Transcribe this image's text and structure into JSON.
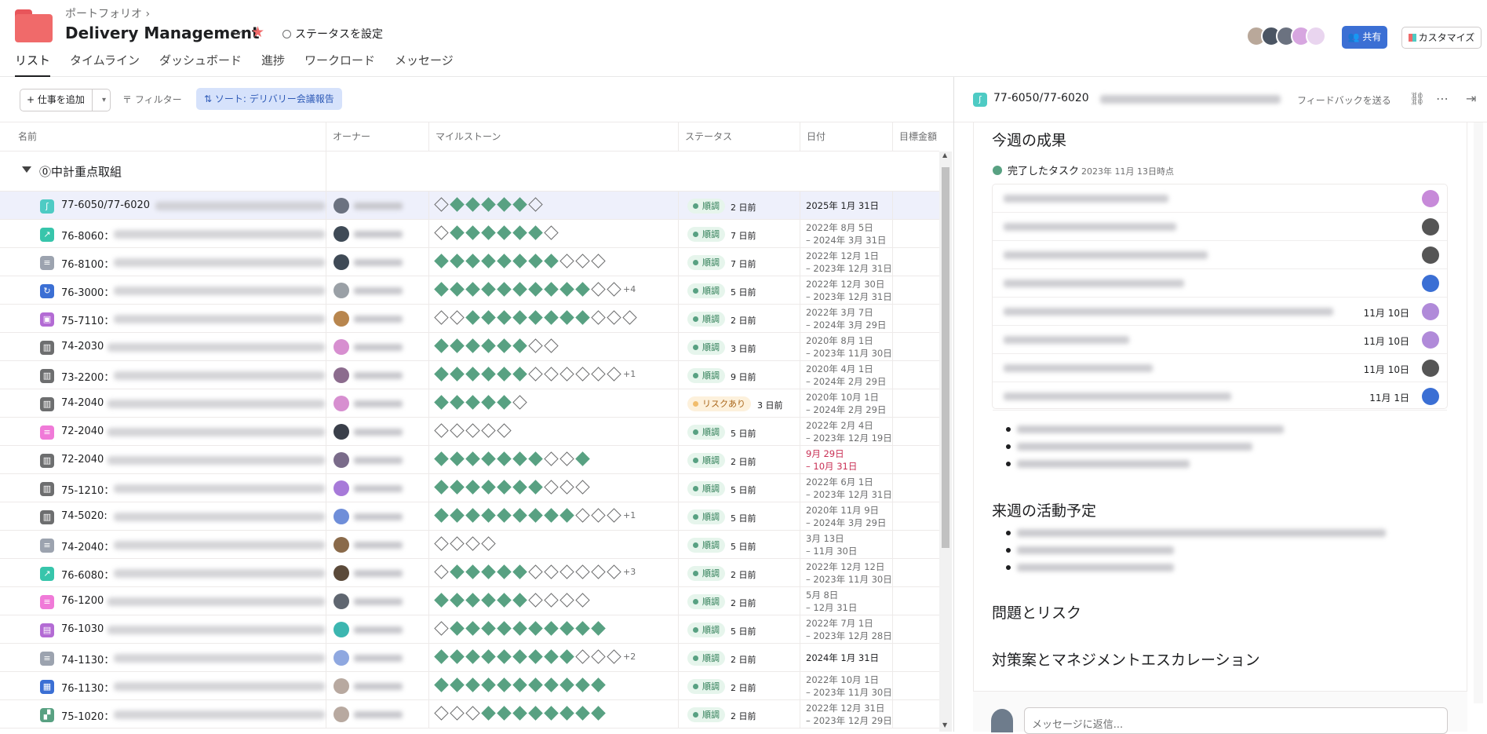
{
  "header": {
    "breadcrumb": "ポートフォリオ",
    "breadcrumb_chevron": "›",
    "title": "Delivery Management",
    "title_chevron": "﹀",
    "star": "★",
    "status_button": "ステータスを設定",
    "tabs": [
      "リスト",
      "タイムライン",
      "ダッシュボード",
      "進捗",
      "ワークロード",
      "メッセージ"
    ],
    "active_tab": "リスト",
    "share_button": "共有",
    "customize_button": "カスタマイズ"
  },
  "toolbar": {
    "add_task": "+ 仕事を追加",
    "add_dropdown": "▾",
    "filter": "〒 フィルター",
    "sort": "⇅ ソート: デリバリー会議報告"
  },
  "columns": [
    "名前",
    "オーナー",
    "マイルストーン",
    "ステータス",
    "日付",
    "目標金額"
  ],
  "section": {
    "label": "⓪中計重点取組"
  },
  "rows": [
    {
      "id": "77-6050/77-6020",
      "icon_color": "#4ecbc4",
      "icon": "ʃ",
      "milestones": [
        0,
        1,
        1,
        1,
        1,
        1,
        0
      ],
      "more": "",
      "status": "順調",
      "status_kind": "ok",
      "ago": "2 日前",
      "date1": "2025年 1月 31日",
      "date2": "",
      "date_red": false,
      "owner_color": "#6b7280"
    },
    {
      "id": "76-8060：",
      "icon_color": "#37c5ab",
      "icon": "↗",
      "milestones": [
        0,
        1,
        1,
        1,
        1,
        1,
        1,
        0
      ],
      "more": "",
      "status": "順調",
      "status_kind": "ok",
      "ago": "7 日前",
      "date1": "2022年 8月 5日",
      "date2": "– 2024年 3月 31日",
      "date_red": false,
      "owner_color": "#3f4a56"
    },
    {
      "id": "76-8100：",
      "icon_color": "#9ca3af",
      "icon": "≡",
      "milestones": [
        1,
        1,
        1,
        1,
        1,
        1,
        1,
        1,
        0,
        0,
        0
      ],
      "more": "",
      "status": "順調",
      "status_kind": "ok",
      "ago": "7 日前",
      "date1": "2022年 12月 1日",
      "date2": "– 2023年 12月 31日",
      "date_red": false,
      "owner_color": "#3f4a56"
    },
    {
      "id": "76-3000：",
      "icon_color": "#3b6fd4",
      "icon": "↻",
      "milestones": [
        1,
        1,
        1,
        1,
        1,
        1,
        1,
        1,
        1,
        1,
        0,
        0
      ],
      "more": "+4",
      "status": "順調",
      "status_kind": "ok",
      "ago": "5 日前",
      "date1": "2022年 12月 30日",
      "date2": "– 2023年 12月 31日",
      "date_red": false,
      "owner_color": "#9aa0a6"
    },
    {
      "id": "75-7110：",
      "icon_color": "#b36bd4",
      "icon": "▣",
      "milestones": [
        0,
        0,
        1,
        1,
        1,
        1,
        1,
        1,
        1,
        1,
        0,
        0,
        0
      ],
      "more": "",
      "status": "順調",
      "status_kind": "ok",
      "ago": "2 日前",
      "date1": "2022年 3月 7日",
      "date2": "– 2024年 3月 29日",
      "date_red": false,
      "owner_color": "#b8864e"
    },
    {
      "id": "74-2030",
      "icon_color": "#6d6e6f",
      "icon": "▥",
      "milestones": [
        1,
        1,
        1,
        1,
        1,
        1,
        0,
        0
      ],
      "more": "",
      "status": "順調",
      "status_kind": "ok",
      "ago": "3 日前",
      "date1": "2020年 8月 1日",
      "date2": "– 2023年 11月 30日",
      "date_red": false,
      "owner_color": "#d78fd0"
    },
    {
      "id": "73-2200：",
      "icon_color": "#6d6e6f",
      "icon": "▥",
      "milestones": [
        1,
        1,
        1,
        1,
        1,
        1,
        0,
        0,
        0,
        0,
        0,
        0
      ],
      "more": "+1",
      "status": "順調",
      "status_kind": "ok",
      "ago": "9 日前",
      "date1": "2020年 4月 1日",
      "date2": "– 2024年 2月 29日",
      "date_red": false,
      "owner_color": "#8c6c8e"
    },
    {
      "id": "74-2040",
      "icon_color": "#6d6e6f",
      "icon": "▥",
      "milestones": [
        1,
        1,
        1,
        1,
        1,
        0
      ],
      "more": "",
      "status": "リスクあり",
      "status_kind": "risk",
      "ago": "3 日前",
      "date1": "2020年 10月 1日",
      "date2": "– 2024年 2月 29日",
      "date_red": false,
      "owner_color": "#d78fd0"
    },
    {
      "id": "72-2040",
      "icon_color": "#f07ad8",
      "icon": "≡",
      "milestones": [
        0,
        0,
        0,
        0,
        0
      ],
      "more": "",
      "status": "順調",
      "status_kind": "ok",
      "ago": "5 日前",
      "date1": "2022年 2月 4日",
      "date2": "– 2023年 12月 19日",
      "date_red": false,
      "owner_color": "#3a3f4a"
    },
    {
      "id": "72-2040",
      "icon_color": "#6d6e6f",
      "icon": "▥",
      "milestones": [
        1,
        1,
        1,
        1,
        1,
        1,
        1,
        0,
        0,
        1
      ],
      "more": "",
      "status": "順調",
      "status_kind": "ok",
      "ago": "2 日前",
      "date1": "9月 29日",
      "date2": "– 10月 31日",
      "date_red": true,
      "owner_color": "#7a6b8a"
    },
    {
      "id": "75-1210：",
      "icon_color": "#6d6e6f",
      "icon": "▥",
      "milestones": [
        1,
        1,
        1,
        1,
        1,
        1,
        1,
        0,
        0,
        0
      ],
      "more": "",
      "status": "順調",
      "status_kind": "ok",
      "ago": "5 日前",
      "date1": "2022年 6月 1日",
      "date2": "– 2023年 12月 31日",
      "date_red": false,
      "owner_color": "#a77ad9"
    },
    {
      "id": "74-5020:",
      "icon_color": "#6d6e6f",
      "icon": "▥",
      "milestones": [
        1,
        1,
        1,
        1,
        1,
        1,
        1,
        1,
        1,
        0,
        0,
        0
      ],
      "more": "+1",
      "status": "順調",
      "status_kind": "ok",
      "ago": "5 日前",
      "date1": "2020年 11月 9日",
      "date2": "– 2024年 3月 29日",
      "date_red": false,
      "owner_color": "#6f8ed9"
    },
    {
      "id": "74-2040：",
      "icon_color": "#9ca3af",
      "icon": "≡",
      "milestones": [
        0,
        0,
        0,
        0
      ],
      "more": "",
      "status": "順調",
      "status_kind": "ok",
      "ago": "5 日前",
      "date1": "3月 13日",
      "date2": "– 11月 30日",
      "date_red": false,
      "owner_color": "#8a6a4a"
    },
    {
      "id": "76-6080：",
      "icon_color": "#37c5ab",
      "icon": "↗",
      "milestones": [
        0,
        1,
        1,
        1,
        1,
        1,
        0,
        0,
        0,
        0,
        0,
        0
      ],
      "more": "+3",
      "status": "順調",
      "status_kind": "ok",
      "ago": "2 日前",
      "date1": "2022年 12月 12日",
      "date2": "– 2023年 11月 30日",
      "date_red": false,
      "owner_color": "#5b4a3a"
    },
    {
      "id": "76-1200",
      "icon_color": "#f07ad8",
      "icon": "≡",
      "milestones": [
        1,
        1,
        1,
        1,
        1,
        1,
        0,
        0,
        0,
        0
      ],
      "more": "",
      "status": "順調",
      "status_kind": "ok",
      "ago": "2 日前",
      "date1": "5月 8日",
      "date2": "– 12月 31日",
      "date_red": false,
      "owner_color": "#5f6670"
    },
    {
      "id": "76-1030",
      "icon_color": "#b36bd4",
      "icon": "▤",
      "milestones": [
        0,
        1,
        1,
        1,
        1,
        1,
        1,
        1,
        1,
        1,
        1
      ],
      "more": "",
      "status": "順調",
      "status_kind": "ok",
      "ago": "5 日前",
      "date1": "2022年 7月 1日",
      "date2": "– 2023年 12月 28日",
      "date_red": false,
      "owner_color": "#3cb6b0"
    },
    {
      "id": "74-1130：",
      "icon_color": "#9ca3af",
      "icon": "≡",
      "milestones": [
        1,
        1,
        1,
        1,
        1,
        1,
        1,
        1,
        1,
        0,
        0,
        0
      ],
      "more": "+2",
      "status": "順調",
      "status_kind": "ok",
      "ago": "2 日前",
      "date1": "2024年 1月 31日",
      "date2": "",
      "date_red": false,
      "owner_color": "#8fa8e0"
    },
    {
      "id": "76-1130：",
      "icon_color": "#3b6fd4",
      "icon": "▦",
      "milestones": [
        1,
        1,
        1,
        1,
        1,
        1,
        1,
        1,
        1,
        1,
        1
      ],
      "more": "",
      "status": "順調",
      "status_kind": "ok",
      "ago": "2 日前",
      "date1": "2022年 10月 1日",
      "date2": "– 2023年 11月 30日",
      "date_red": false,
      "owner_color": "#b8a9a0"
    },
    {
      "id": "75-1020：",
      "icon_color": "#58a182",
      "icon": "▞",
      "milestones": [
        0,
        0,
        0,
        1,
        1,
        1,
        1,
        1,
        1,
        1,
        1
      ],
      "more": "",
      "status": "順調",
      "status_kind": "ok",
      "ago": "2 日前",
      "date1": "2022年 12月 31日",
      "date2": "– 2023年 12月 29日",
      "date_red": false,
      "owner_color": "#b8a9a0"
    }
  ],
  "panel": {
    "task_id": "77-6050/77-6020",
    "feedback": "フィードバックを送る",
    "link_icon": "⛓",
    "more_icon": "⋯",
    "close_icon": "⇥",
    "section_this_week": "今週の成果",
    "done_tasks": "完了したタスク",
    "as_of": "2023年 11月 13日時点",
    "task_dates": [
      "",
      "",
      "",
      "",
      "11月 10日",
      "11月 10日",
      "11月 10日",
      "11月 1日"
    ],
    "task_avatar_colors": [
      "#c78ad9",
      "#555",
      "#555",
      "#3b6fd4",
      "#b08ad9",
      "#b08ad9",
      "#555",
      "#3b6fd4"
    ],
    "section_next_week": "来週の活動予定",
    "section_issues": "問題とリスク",
    "section_escalation": "対策案とマネジメントエスカレーション",
    "reply_placeholder": "メッセージに返信..."
  },
  "colors": {
    "accent_blue": "#3b6fd4",
    "done_green": "#58a182",
    "risk_amber": "#f1bd6c",
    "brand_coral": "#f06a6a"
  }
}
